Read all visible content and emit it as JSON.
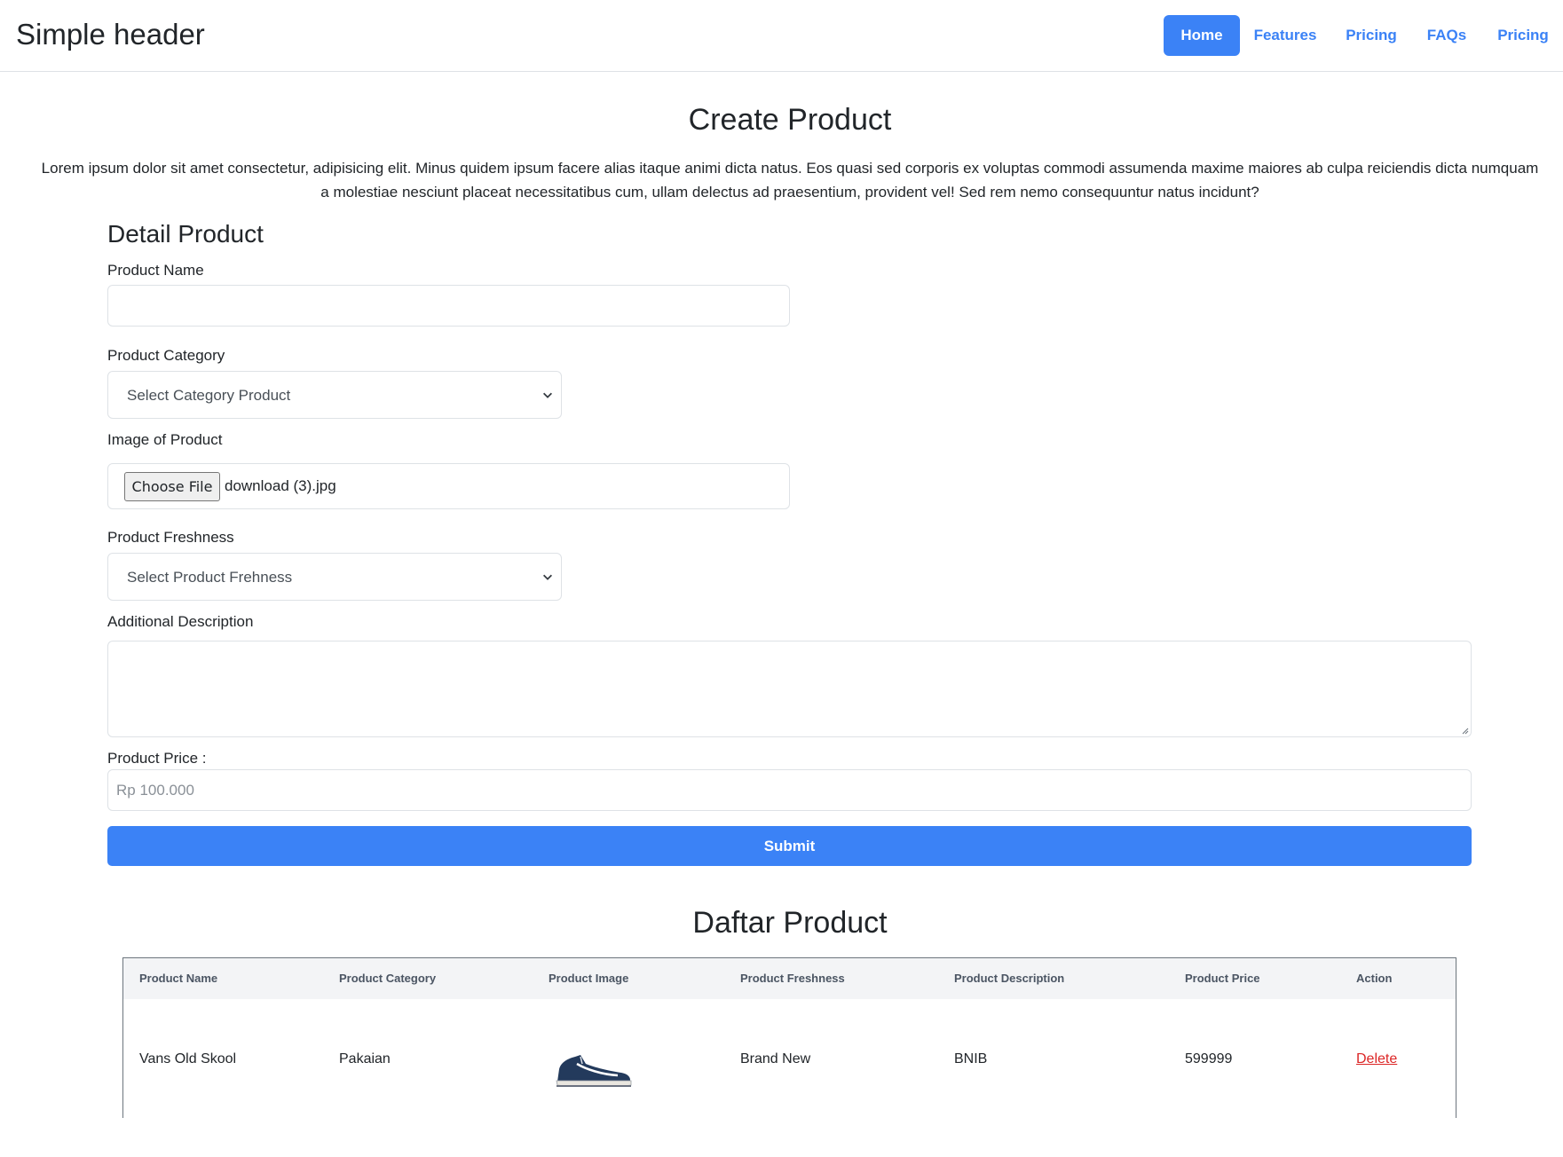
{
  "header": {
    "brand": "Simple header",
    "nav": [
      {
        "label": "Home",
        "active": true
      },
      {
        "label": "Features",
        "active": false
      },
      {
        "label": "Pricing",
        "active": false
      },
      {
        "label": "FAQs",
        "active": false
      },
      {
        "label": "Pricing",
        "active": false
      }
    ]
  },
  "main": {
    "title": "Create Product",
    "lead": "Lorem ipsum dolor sit amet consectetur, adipisicing elit. Minus quidem ipsum facere alias itaque animi dicta natus. Eos quasi sed corporis ex voluptas commodi assumenda maxime maiores ab culpa reiciendis dicta numquam a molestiae nesciunt placeat necessitatibus cum, ullam delectus ad praesentium, provident vel! Sed rem nemo consequuntur natus incidunt?"
  },
  "form": {
    "section_title": "Detail Product",
    "product_name": {
      "label": "Product Name",
      "value": ""
    },
    "category": {
      "label": "Product Category",
      "selected": "Select Category Product"
    },
    "image": {
      "label": "Image of Product",
      "button": "Choose File",
      "file_name": "download (3).jpg"
    },
    "freshness": {
      "label": "Product Freshness",
      "selected": "Select Product Frehness"
    },
    "description": {
      "label": "Additional Description",
      "value": ""
    },
    "price": {
      "label": "Product Price :",
      "placeholder": "Rp 100.000"
    },
    "submit_label": "Submit"
  },
  "list": {
    "title": "Daftar Product",
    "columns": [
      "Product Name",
      "Product Category",
      "Product Image",
      "Product Freshness",
      "Product Description",
      "Product Price",
      "Action"
    ],
    "rows": [
      {
        "name": "Vans Old Skool",
        "category": "Pakaian",
        "image_icon": "sneaker-image",
        "freshness": "Brand New",
        "description": "BNIB",
        "price": "599999",
        "action": "Delete"
      }
    ]
  },
  "colors": {
    "accent": "#3b82f6",
    "danger": "#dc2626",
    "border": "#dee2e6"
  }
}
